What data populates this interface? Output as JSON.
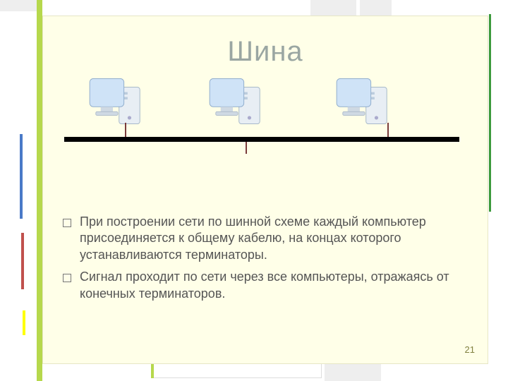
{
  "title": "Шина",
  "bullets": [
    "При построении сети по шинной схеме каждый компьютер присоединяется к общему кабелю, на концах которого устанавливаются терминаторы.",
    "Сигнал проходит по сети через все компьютеры, отражаясь от конечных терминаторов."
  ],
  "page_number": "21",
  "diagram": {
    "type": "bus-topology",
    "nodes": [
      "компьютер 1",
      "компьютер 2",
      "компьютер 3"
    ]
  },
  "accent_colors": {
    "lime": "#b6d84c",
    "green": "#3c9a3c",
    "blue": "#4a7ac8",
    "red": "#c0504d",
    "yellow": "#ffff00",
    "gray": "#e0e0e0"
  }
}
